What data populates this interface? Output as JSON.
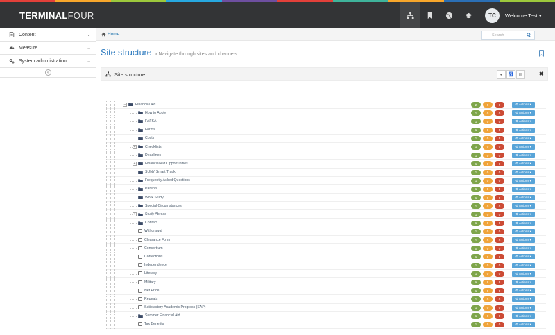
{
  "brand": {
    "bold": "TERMINAL",
    "light": "FOUR"
  },
  "stripe_colors": [
    "#e3403a",
    "#f7a62b",
    "#9cc83c",
    "#27a8e0",
    "#6e4fa0",
    "#e3403a",
    "#3fb39b",
    "#f7a62b",
    "#2b6fb5",
    "#9cc83c"
  ],
  "topbar": {
    "icons": [
      "sitemap-icon",
      "bookmark-icon",
      "globe-icon",
      "graduation-cap-icon"
    ],
    "avatar_initials": "TC",
    "user_label": "Welcome Test ▾"
  },
  "sidebar": {
    "items": [
      {
        "label": "Content",
        "icon": "file-icon"
      },
      {
        "label": "Measure",
        "icon": "dashboard-icon"
      },
      {
        "label": "System administration",
        "icon": "cogs-icon"
      }
    ],
    "chevron": "⌄",
    "collapse_glyph": "«"
  },
  "breadcrumb": {
    "home": "Home"
  },
  "search": {
    "placeholder": "Search"
  },
  "page": {
    "title": "Site structure",
    "subtitle": "» Navigate through sites and channels"
  },
  "panel": {
    "title": "Site structure",
    "tools": [
      "●",
      "♿",
      "▤"
    ],
    "expand": "✖"
  },
  "actions_label": "⚙ Actions ▾",
  "colors": {
    "badge_green": "#7ea54a",
    "badge_orange": "#f0a43a",
    "badge_red": "#cc4b35",
    "actions": "#58a4d8",
    "title_blue": "#2e7bbf"
  },
  "tree": [
    {
      "label": "Financial Aid",
      "depth": 0,
      "type": "folder",
      "expander": "−",
      "badges": [
        "2",
        "0",
        "0"
      ]
    },
    {
      "label": "How to Apply",
      "depth": 1,
      "type": "folder",
      "badges": [
        "1",
        "0",
        "0"
      ]
    },
    {
      "label": "FAFSA",
      "depth": 1,
      "type": "folder",
      "badges": [
        "1",
        "0",
        "0"
      ]
    },
    {
      "label": "Forms",
      "depth": 1,
      "type": "folder",
      "badges": [
        "1",
        "0",
        "5"
      ]
    },
    {
      "label": "Costs",
      "depth": 1,
      "type": "folder",
      "badges": [
        "1",
        "0",
        "9"
      ]
    },
    {
      "label": "Checklists",
      "depth": 1,
      "type": "folder",
      "expander": "+",
      "badges": [
        "1",
        "0",
        "0"
      ]
    },
    {
      "label": "Deadlines",
      "depth": 1,
      "type": "folder",
      "badges": [
        "1",
        "0",
        "0"
      ]
    },
    {
      "label": "Financial Aid Opportunities",
      "depth": 1,
      "type": "folder",
      "expander": "+",
      "badges": [
        "1",
        "0",
        "0"
      ]
    },
    {
      "label": "SUNY Smart Track",
      "depth": 1,
      "type": "folder",
      "badges": [
        "1",
        "0",
        "0"
      ]
    },
    {
      "label": "Frequently Asked Questions",
      "depth": 1,
      "type": "folder",
      "badges": [
        "1",
        "0",
        "0"
      ]
    },
    {
      "label": "Parents",
      "depth": 1,
      "type": "folder",
      "badges": [
        "1",
        "0",
        "0"
      ]
    },
    {
      "label": "Work Study",
      "depth": 1,
      "type": "folder",
      "badges": [
        "1",
        "0",
        "0"
      ]
    },
    {
      "label": "Special Circumstances",
      "depth": 1,
      "type": "folder",
      "badges": [
        "1",
        "0",
        "0"
      ]
    },
    {
      "label": "Study Abroad",
      "depth": 1,
      "type": "folder",
      "expander": "+",
      "badges": [
        "1",
        "0",
        "0"
      ]
    },
    {
      "label": "Contact",
      "depth": 1,
      "type": "folder",
      "badges": [
        "1",
        "0",
        "0"
      ]
    },
    {
      "label": "Withdrawal",
      "depth": 1,
      "type": "page",
      "badges": [
        "1",
        "0",
        "0"
      ]
    },
    {
      "label": "Clearance Form",
      "depth": 1,
      "type": "page",
      "badges": [
        "1",
        "0",
        "0"
      ]
    },
    {
      "label": "Consortium",
      "depth": 1,
      "type": "page",
      "badges": [
        "0",
        "0",
        "0"
      ]
    },
    {
      "label": "Corrections",
      "depth": 1,
      "type": "page",
      "badges": [
        "1",
        "0",
        "0"
      ]
    },
    {
      "label": "Independence",
      "depth": 1,
      "type": "page",
      "badges": [
        "1",
        "0",
        "0"
      ]
    },
    {
      "label": "Literacy",
      "depth": 1,
      "type": "page",
      "badges": [
        "1",
        "0",
        "0"
      ]
    },
    {
      "label": "Military",
      "depth": 1,
      "type": "page",
      "badges": [
        "1",
        "0",
        "0"
      ]
    },
    {
      "label": "Net Price",
      "depth": 1,
      "type": "page",
      "badges": [
        "1",
        "0",
        "0"
      ]
    },
    {
      "label": "Repeats",
      "depth": 1,
      "type": "page",
      "badges": [
        "1",
        "0",
        "0"
      ]
    },
    {
      "label": "Satisfactory Academic Progress (SAP)",
      "depth": 1,
      "type": "page",
      "badges": [
        "1",
        "0",
        "0"
      ]
    },
    {
      "label": "Summer Financial Aid",
      "depth": 1,
      "type": "folder",
      "badges": [
        "1",
        "0",
        "0"
      ]
    },
    {
      "label": "Tax Benefits",
      "depth": 1,
      "type": "page",
      "badges": [
        "1",
        "0",
        "0"
      ]
    }
  ]
}
